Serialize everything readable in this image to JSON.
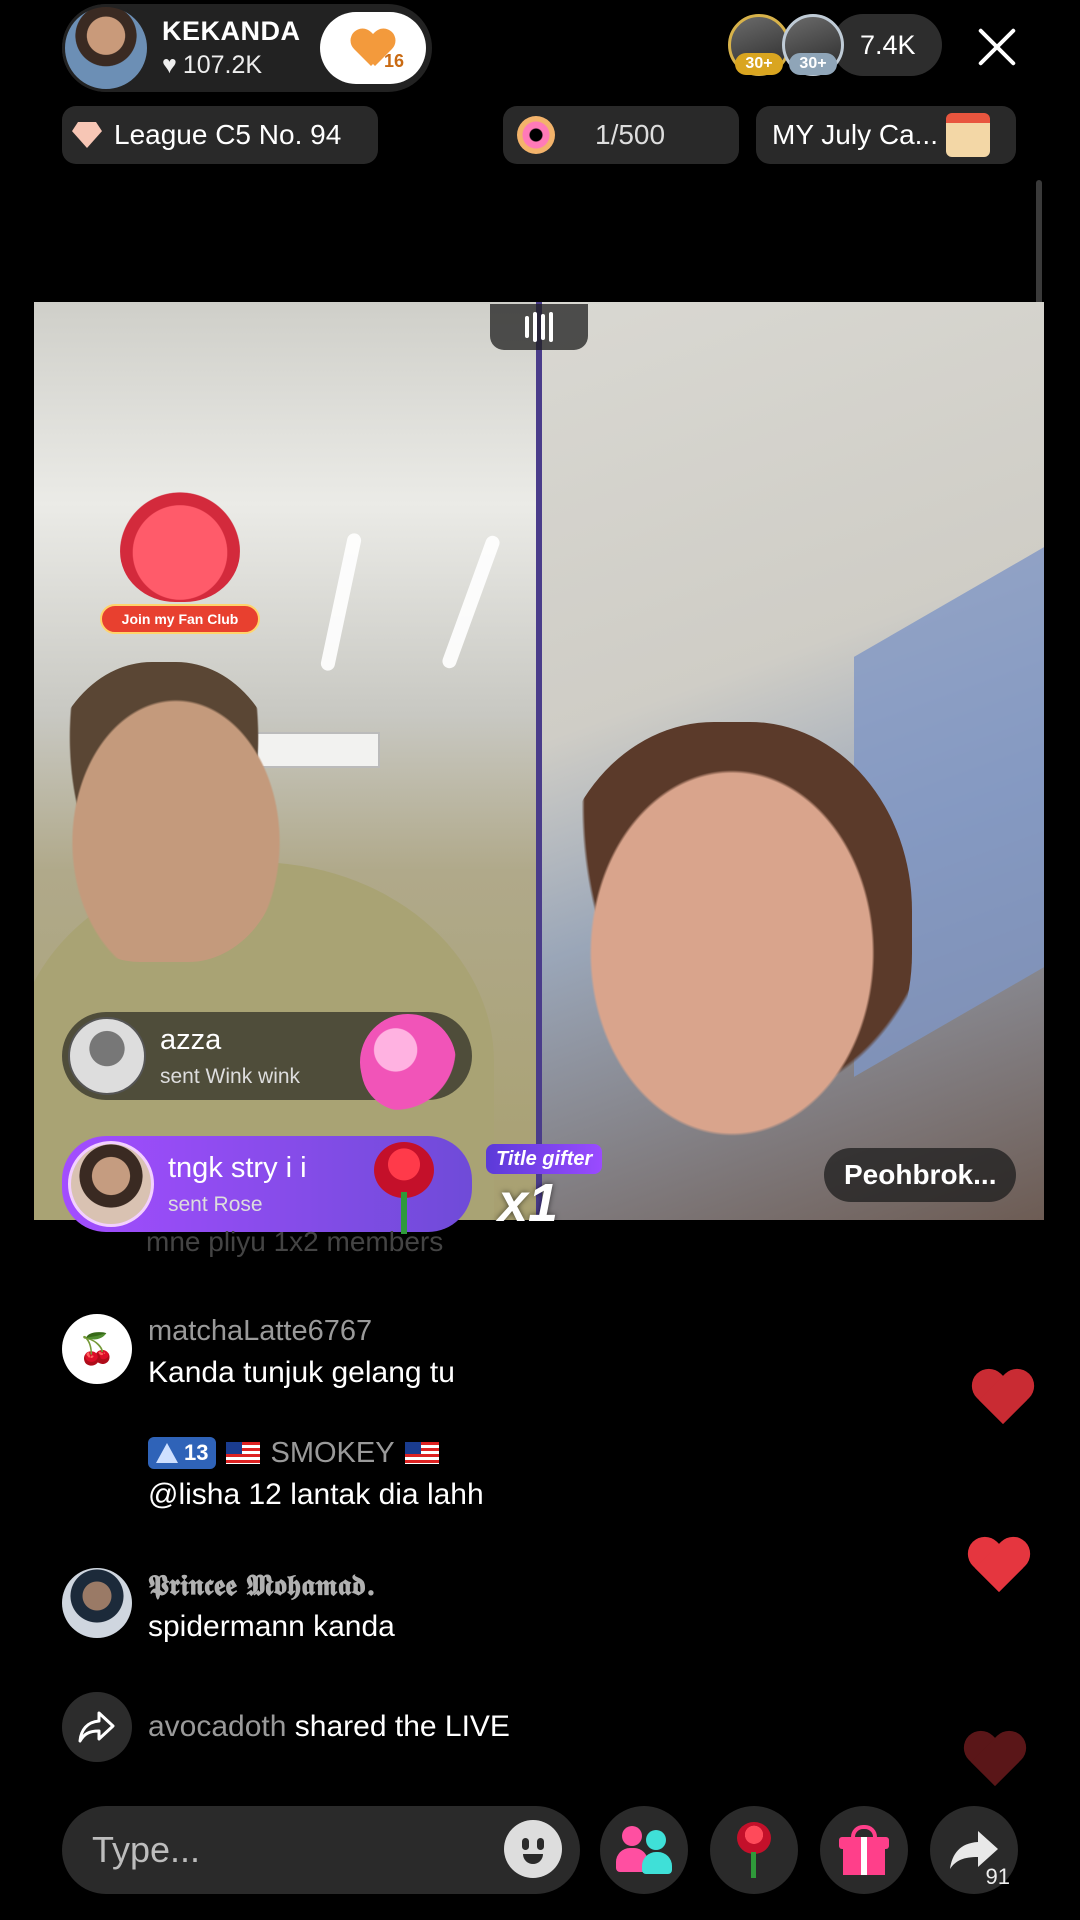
{
  "header": {
    "host_name": "KEKANDA",
    "host_likes": "107.2K",
    "follow_count": "16",
    "viewer_badges": [
      "30+",
      "30+"
    ],
    "viewer_count": "7.4K",
    "league": "League C5 No. 94",
    "goal_progress": "1/500",
    "campaign": "MY July Ca..."
  },
  "video": {
    "fan_club_label": "Join my Fan Club",
    "gifts": [
      {
        "user": "azza",
        "action": "sent Wink wink"
      },
      {
        "user": "tngk stry i i",
        "action": "sent Rose"
      }
    ],
    "title_gifter": "Title gifter",
    "combo": "x1",
    "opponent_name": "Peohbrok..."
  },
  "chat": {
    "faded_line": "mne pliyu 1x2 members",
    "messages": [
      {
        "user": "matchaLatte6767",
        "text": "Kanda tunjuk gelang tu",
        "avatar": "cherry-icon"
      },
      {
        "user": "SMOKEY",
        "level": "13",
        "text": "@lisha 12 lantak dia lahh"
      },
      {
        "user": "𝕻𝖗𝖎𝖓𝖈𝖊𝖊 𝕸𝖔𝖍𝖆𝖒𝖆𝖉.",
        "text": "spidermann kanda"
      }
    ],
    "share_event": {
      "user": "avocadoth",
      "text": "shared the LIVE"
    }
  },
  "bottom_bar": {
    "type_placeholder": "Type...",
    "share_count": "91"
  },
  "colors": {
    "accent_pink": "#ff3f8a",
    "heart_red": "#e5363f",
    "gifter_purple": "#8a4bff",
    "background": "#000000"
  }
}
